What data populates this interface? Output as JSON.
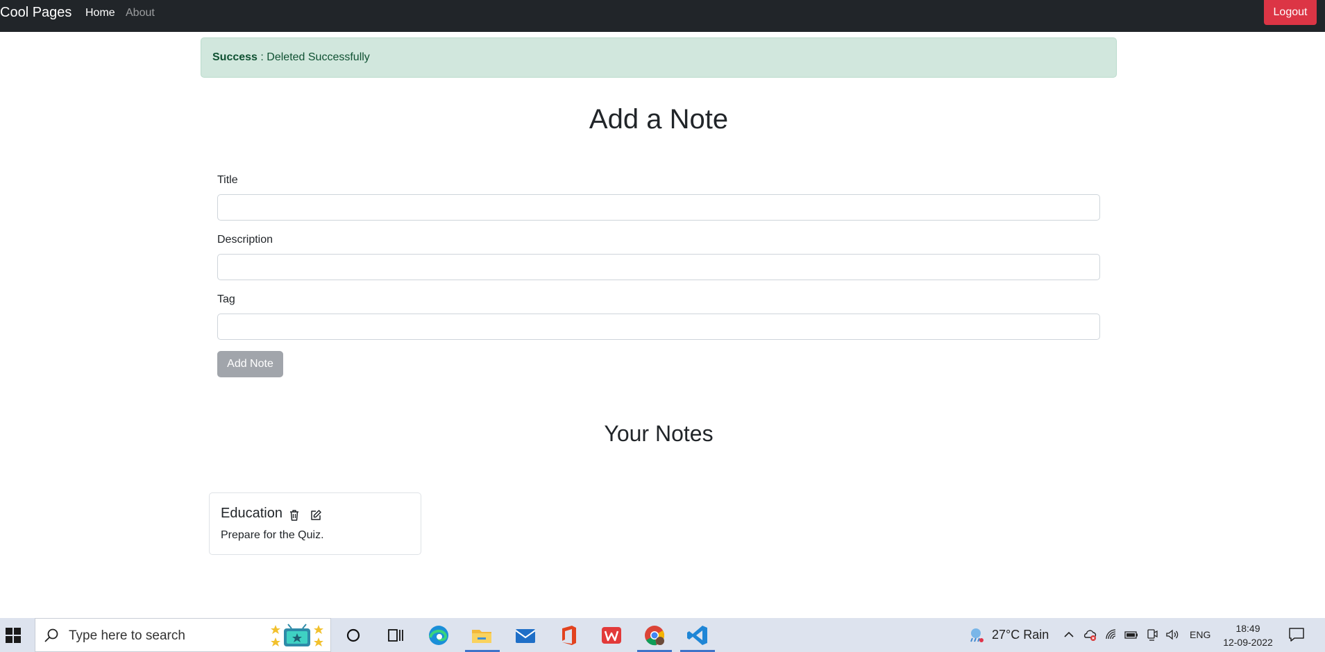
{
  "navbar": {
    "brand": "Cool Pages",
    "home": "Home",
    "about": "About",
    "logout": "Logout"
  },
  "alert": {
    "type": "Success",
    "message": ": Deleted Successfully"
  },
  "form": {
    "heading": "Add a Note",
    "title_label": "Title",
    "title_value": "",
    "description_label": "Description",
    "description_value": "",
    "tag_label": "Tag",
    "tag_value": "",
    "submit_label": "Add Note"
  },
  "notes": {
    "heading": "Your Notes",
    "items": [
      {
        "title": "Education",
        "description": "Prepare for the Quiz."
      }
    ]
  },
  "taskbar": {
    "search_placeholder": "Type here to search",
    "weather": "27°C  Rain",
    "language": "ENG",
    "time": "18:49",
    "date": "12-09-2022",
    "apps": [
      "cortana-icon",
      "task-view-icon",
      "edge-icon",
      "file-explorer-icon",
      "mail-icon",
      "office-icon",
      "wps-icon",
      "chrome-icon",
      "vscode-icon"
    ]
  },
  "colors": {
    "navbar_bg": "#212529",
    "danger": "#dc3545",
    "alert_bg": "#d1e7dd",
    "alert_text": "#0f5132",
    "disabled_button": "#a1a5ab",
    "taskbar_bg": "#dde3ee"
  }
}
